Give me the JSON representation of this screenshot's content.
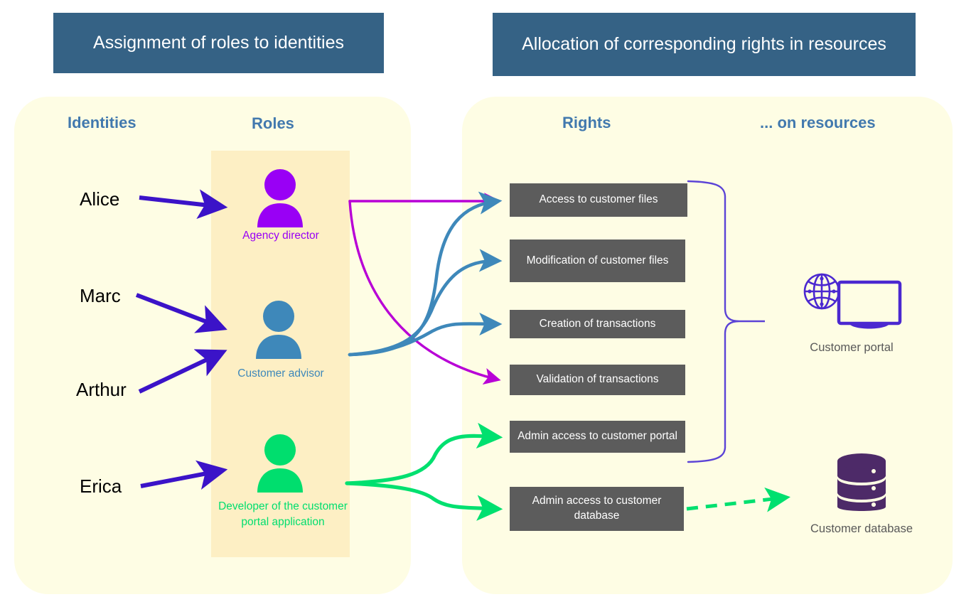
{
  "headers": {
    "left": "Assignment of roles to identities",
    "right": "Allocation of corresponding rights in resources"
  },
  "columns": {
    "identities": "Identities",
    "roles": "Roles",
    "rights": "Rights",
    "resources": "... on resources"
  },
  "identities": [
    {
      "name": "Alice",
      "role_index": 0
    },
    {
      "name": "Marc",
      "role_index": 1
    },
    {
      "name": "Arthur",
      "role_index": 1
    },
    {
      "name": "Erica",
      "role_index": 2
    }
  ],
  "roles": [
    {
      "label": "Agency director",
      "color": "#9900F5",
      "icon": "person-icon"
    },
    {
      "label": "Customer advisor",
      "color": "#3E88BA",
      "icon": "person-icon"
    },
    {
      "label": "Developer of the customer portal application",
      "color": "#00DE6E",
      "icon": "person-icon"
    }
  ],
  "rights": [
    {
      "label": "Access to customer files"
    },
    {
      "label": "Modification of customer files"
    },
    {
      "label": "Creation of transactions"
    },
    {
      "label": "Validation of transactions"
    },
    {
      "label": "Admin access to customer portal"
    },
    {
      "label": "Admin access to customer database"
    }
  ],
  "resources": [
    {
      "label": "Customer portal",
      "icon": "monitor-globe-icon",
      "color": "#4B28D0"
    },
    {
      "label": "Customer database",
      "icon": "database-icon",
      "color": "#4D2A68"
    }
  ],
  "links": {
    "agency_director_rights": [
      "Access to customer files",
      "Validation of transactions"
    ],
    "customer_advisor_rights": [
      "Access to customer files",
      "Modification of customer files",
      "Creation of transactions"
    ],
    "developer_rights": [
      "Admin access to customer portal",
      "Admin access to customer database"
    ],
    "brace_rights_to_customer_portal": [
      "Access to customer files",
      "Modification of customer files",
      "Creation of transactions",
      "Validation of transactions",
      "Admin access to customer portal"
    ],
    "dashed_link_to_customer_database": "Admin access to customer database"
  },
  "colors": {
    "banner": "#356285",
    "panel": "#FEFDE4",
    "roles_band": "#FDEFC4",
    "right_box": "#5C5C5C",
    "heading": "#4279AE",
    "identity_arrow": "#3B13C8",
    "agency_director": "#9900F5",
    "customer_advisor": "#3E88BA",
    "developer": "#00DE6E",
    "brace": "#5B43D6",
    "resource_portal": "#4B28D0",
    "resource_database": "#4D2A68"
  }
}
